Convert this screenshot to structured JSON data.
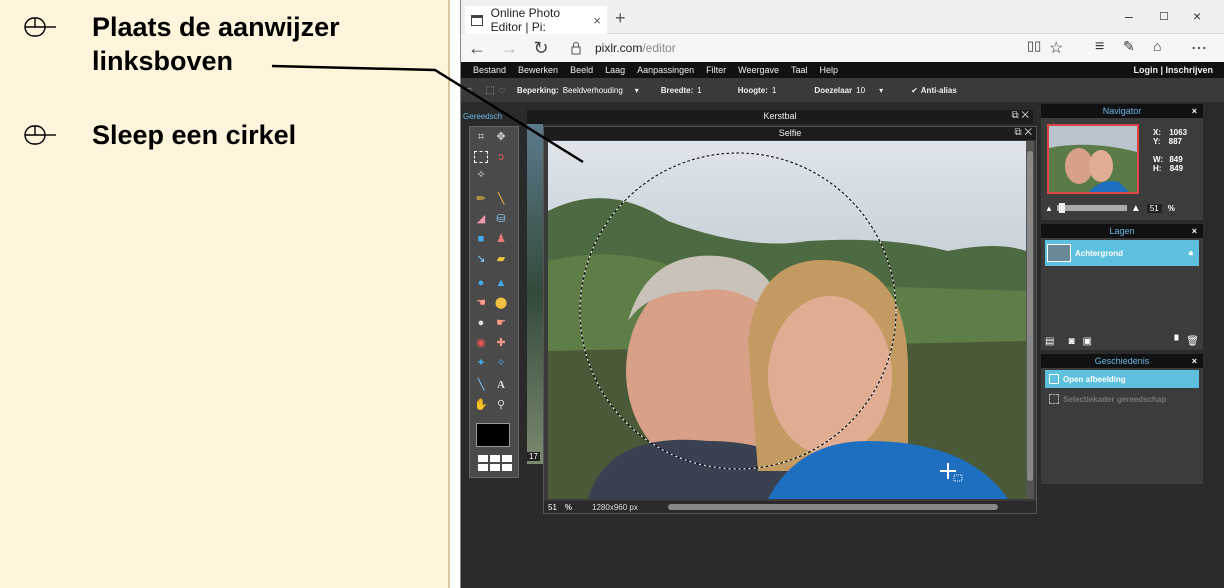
{
  "instructions": {
    "step1_line1": "Plaats de aanwijzer",
    "step1_line2": "linksboven",
    "step2": "Sleep een cirkel",
    "mouse_icon": "mouse-icon"
  },
  "browser": {
    "tab_title": "Online Photo Editor | Pi:",
    "tab_close": "×",
    "new_tab": "+",
    "url_host": "pixlr.com",
    "url_path": "/editor",
    "back": "←",
    "forward": "→",
    "refresh": "↻",
    "minimize": "–",
    "maximize": "☐",
    "close": "×"
  },
  "menu": {
    "items": [
      "Bestand",
      "Bewerken",
      "Beeld",
      "Laag",
      "Aanpassingen",
      "Filter",
      "Weergave",
      "Taal",
      "Help"
    ],
    "login": "Login  |  Inschrijven"
  },
  "options": {
    "beperking_label": "Beperking:",
    "beperking_value": "Beeldverhouding",
    "breedte_label": "Breedte:",
    "breedte_value": "1",
    "hoogte_label": "Hoogte:",
    "hoogte_value": "1",
    "doezelaar_label": "Doezelaar",
    "doezelaar_value": "10",
    "antialias_label": "Anti-alias",
    "antialias_checked": true
  },
  "tools_panel": {
    "title": "Gereedsch",
    "text_tool": "A"
  },
  "documents": {
    "back_title": "Kerstbal",
    "front_title": "Selfie",
    "back_zoom": "17",
    "zoom": "51",
    "zoom_unit": "%",
    "dimensions": "1280x960 px"
  },
  "navigator": {
    "title": "Navigator",
    "x_label": "X:",
    "x_value": "1063",
    "y_label": "Y:",
    "y_value": "887",
    "w_label": "W:",
    "w_value": "849",
    "h_label": "H:",
    "h_value": "849",
    "zoom": "51",
    "zoom_unit": "%"
  },
  "layers": {
    "title": "Lagen",
    "items": [
      {
        "name": "Achtergrond",
        "locked": true
      }
    ]
  },
  "history": {
    "title": "Geschiedenis",
    "items": [
      "Open afbeelding",
      "Selectiekader gereedschap"
    ]
  },
  "colors": {
    "accent": "#5cc0de",
    "panel_title": "#68b8e8",
    "instruction_bg": "#fef5dc"
  }
}
